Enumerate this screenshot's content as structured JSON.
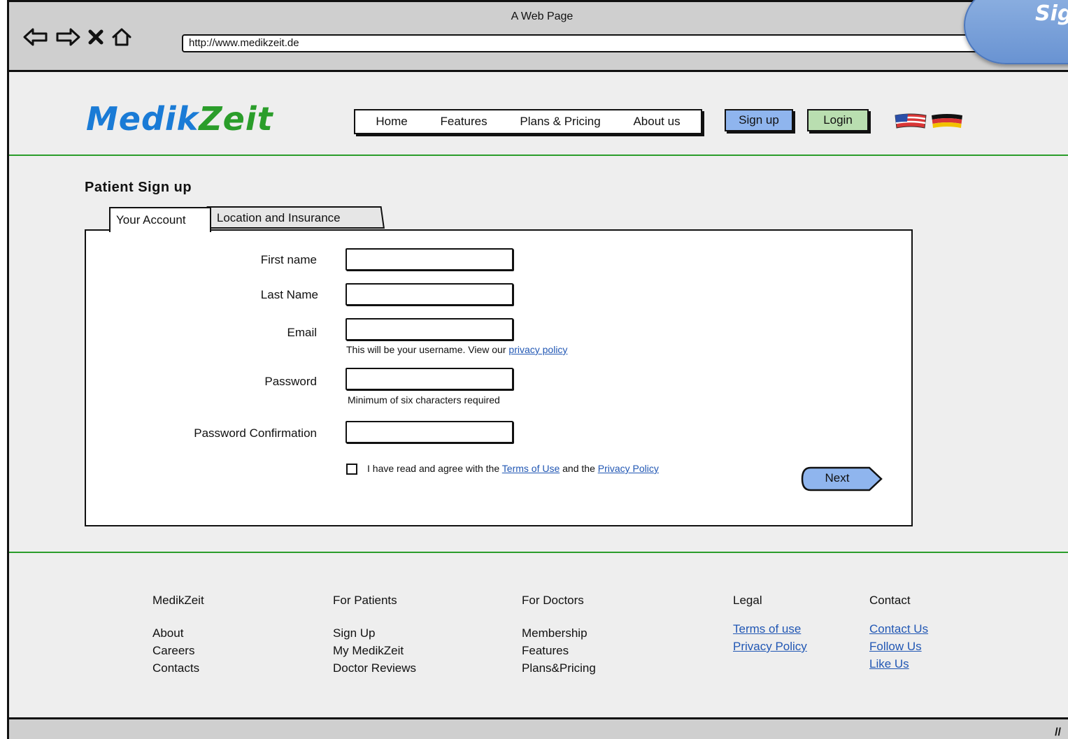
{
  "browser": {
    "window_title": "A Web Page",
    "url": "http://www.medikzeit.de",
    "nav_icons": [
      "back-arrow-icon",
      "forward-arrow-icon",
      "close-x-icon",
      "home-icon"
    ]
  },
  "ribbon": {
    "text": "Sig"
  },
  "header": {
    "logo_part1": "Medik",
    "logo_part2": "Zeit",
    "menu": [
      "Home",
      "Features",
      "Plans & Pricing",
      "About us"
    ],
    "signup_label": "Sign up",
    "login_label": "Login",
    "flags": [
      "us-flag-icon",
      "german-flag-icon"
    ],
    "colors": {
      "logo_blue": "#1a7bd6",
      "logo_green": "#2a9d2a",
      "signup_bg": "#8fb5ee",
      "login_bg": "#b9deb0",
      "accent_line": "#2a9d2a"
    }
  },
  "signup": {
    "heading": "Patient Sign up",
    "tabs": [
      "Your Account",
      "Location and Insurance"
    ],
    "fields": {
      "first_name": {
        "label": "First name",
        "value": ""
      },
      "last_name": {
        "label": "Last Name",
        "value": ""
      },
      "email": {
        "label": "Email",
        "value": ""
      },
      "password": {
        "label": "Password",
        "value": ""
      },
      "password_confirmation": {
        "label": "Password Confirmation",
        "value": ""
      }
    },
    "email_help_prefix": "This will be your username. View our ",
    "email_help_link": "privacy policy",
    "password_help": "Minimum of six characters required",
    "consent_prefix": "I have read and agree with the ",
    "terms_link": "Terms of Use",
    "consent_middle": " and the ",
    "privacy_link": "Privacy Policy",
    "agree_checked": false,
    "next_label": "Next"
  },
  "footer": {
    "columns": [
      {
        "heading": "MedikZeit",
        "items": [
          "About",
          "Careers",
          "Contacts"
        ],
        "links": false
      },
      {
        "heading": "For Patients",
        "items": [
          "Sign Up",
          "My MedikZeit",
          "Doctor Reviews"
        ],
        "links": false
      },
      {
        "heading": "For Doctors",
        "items": [
          "Membership",
          "Features",
          "Plans&Pricing"
        ],
        "links": false
      },
      {
        "heading": "Legal",
        "items": [
          "Terms of use",
          "Privacy Policy"
        ],
        "links": true
      },
      {
        "heading": "Contact",
        "items": [
          "Contact Us",
          "Follow Us",
          "Like Us"
        ],
        "links": true
      }
    ]
  }
}
